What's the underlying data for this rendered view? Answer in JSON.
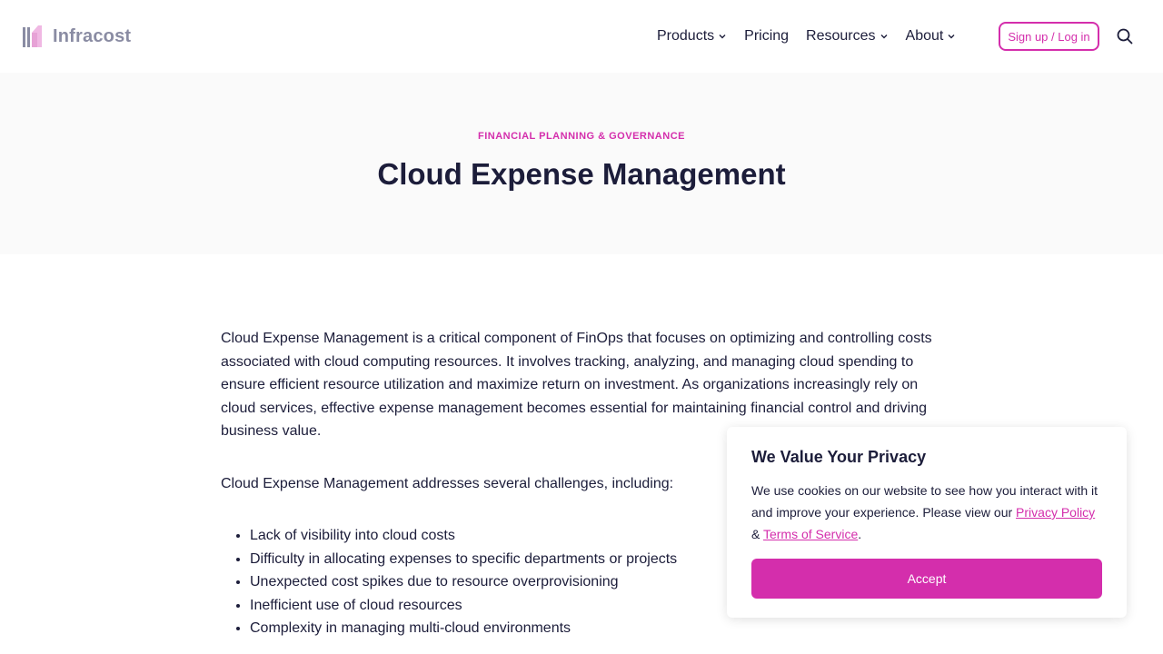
{
  "header": {
    "logo_text": "Infracost",
    "nav": [
      {
        "label": "Products",
        "has_dropdown": true
      },
      {
        "label": "Pricing",
        "has_dropdown": false
      },
      {
        "label": "Resources",
        "has_dropdown": true
      },
      {
        "label": "About",
        "has_dropdown": true
      }
    ],
    "signup_label": "Sign up / Log in",
    "search_icon": "search-icon"
  },
  "hero": {
    "eyebrow": "FINANCIAL PLANNING & GOVERNANCE",
    "title": "Cloud Expense Management"
  },
  "content": {
    "paragraph1": "Cloud Expense Management is a critical component of FinOps that focuses on optimizing and controlling costs associated with cloud computing resources. It involves tracking, analyzing, and managing cloud spending to ensure efficient resource utilization and maximize return on investment. As organizations increasingly rely on cloud services, effective expense management becomes essential for maintaining financial control and driving business value.",
    "paragraph2": "Cloud Expense Management addresses several challenges, including:",
    "challenges": [
      "Lack of visibility into cloud costs",
      "Difficulty in allocating expenses to specific departments or projects",
      "Unexpected cost spikes due to resource overprovisioning",
      "Inefficient use of cloud resources",
      "Complexity in managing multi-cloud environments"
    ]
  },
  "cookie": {
    "title": "We Value Your Privacy",
    "text_before": "We use cookies on our website to see how you interact with it and improve your experience. Please view our ",
    "privacy_link": "Privacy Policy",
    "text_between": " & ",
    "terms_link": "Terms of Service",
    "text_after": ".",
    "accept_label": "Accept"
  },
  "colors": {
    "accent": "#d42eac",
    "text": "#1c1d3a",
    "hero_bg": "#fafafa",
    "logo_gray": "#8a8ca3"
  }
}
